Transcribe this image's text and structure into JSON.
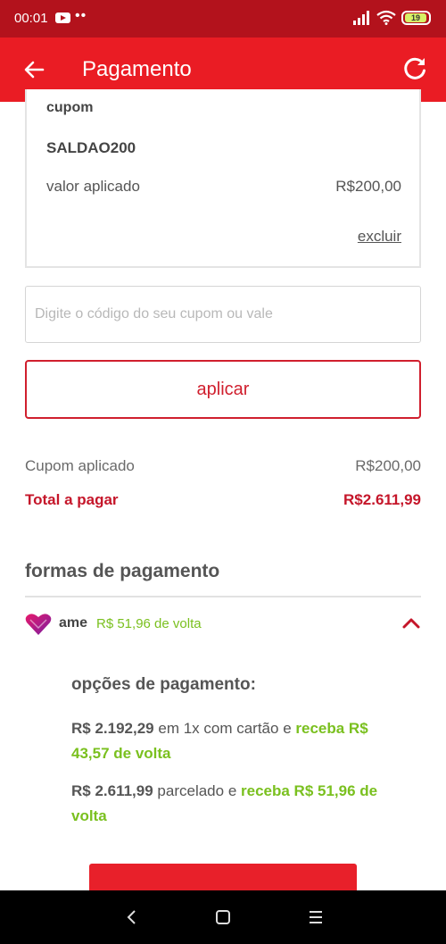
{
  "status_bar": {
    "time": "00:01",
    "dots": "••",
    "battery": "19"
  },
  "app_bar": {
    "title": "Pagamento"
  },
  "coupon_card": {
    "label": "cupom",
    "code": "SALDAO200",
    "applied_label": "valor aplicado",
    "applied_value": "R$200,00",
    "remove_link": "excluir"
  },
  "coupon_input": {
    "placeholder": "Digite o código do seu cupom ou vale",
    "value": ""
  },
  "apply_button": {
    "label": "aplicar"
  },
  "summary": {
    "coupon_label": "Cupom aplicado",
    "coupon_value": "R$200,00",
    "total_label": "Total a pagar",
    "total_value": "R$2.611,99"
  },
  "payment_methods": {
    "title": "formas de pagamento",
    "ame": {
      "name": "ame",
      "cashback": "R$ 51,96 de volta"
    },
    "options_title": "opções de pagamento:",
    "option1": {
      "amount": "R$ 2.192,29",
      "text": " em 1x com cartão e ",
      "highlight": "receba R$ 43,57 de volta"
    },
    "option2": {
      "amount": "R$ 2.611,99",
      "text": " parcelado e ",
      "highlight": "receba R$ 51,96 de volta"
    }
  },
  "colors": {
    "primary": "#ea1c24",
    "status_bar": "#b3121c",
    "cashback_green": "#7ac01f",
    "total_red": "#c5162a"
  },
  "icons": [
    "back-arrow-icon",
    "refresh-icon",
    "ame-heart-icon",
    "chevron-up-icon",
    "nav-back-icon",
    "nav-home-icon",
    "nav-menu-icon"
  ]
}
